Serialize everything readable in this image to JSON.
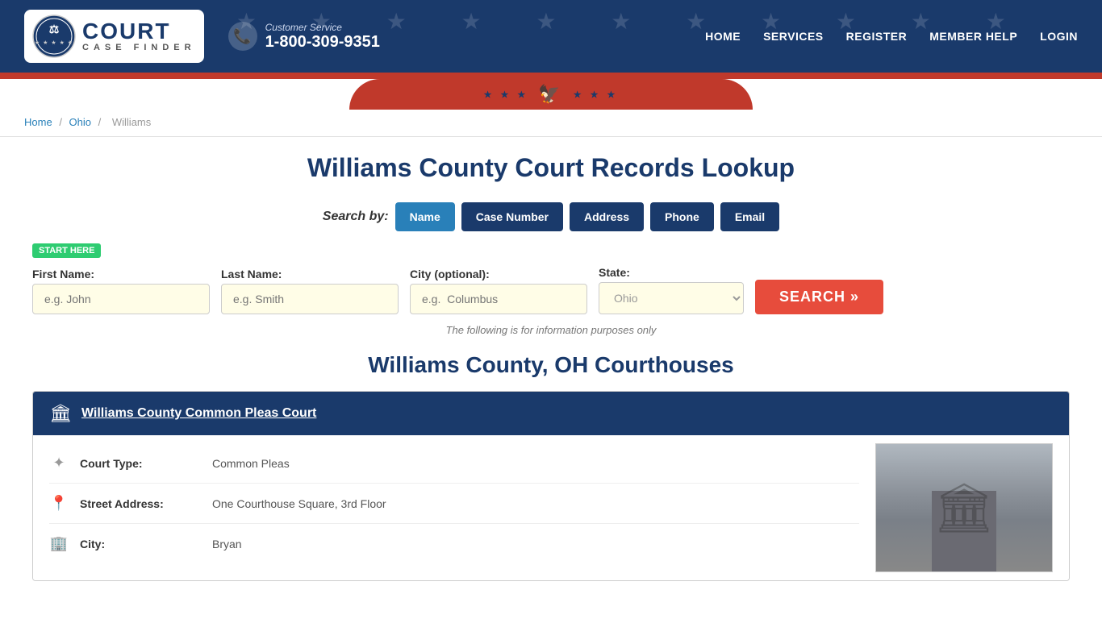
{
  "header": {
    "logo_court": "COURT",
    "logo_case_finder": "CASE FINDER",
    "customer_service_label": "Customer Service",
    "phone": "1-800-309-9351",
    "nav": {
      "home": "HOME",
      "services": "SERVICES",
      "register": "REGISTER",
      "member_help": "MEMBER HELP",
      "login": "LOGIN"
    }
  },
  "breadcrumb": {
    "home": "Home",
    "ohio": "Ohio",
    "williams": "Williams"
  },
  "main": {
    "page_title": "Williams County Court Records Lookup",
    "search_by_label": "Search by:",
    "tabs": [
      {
        "label": "Name",
        "active": true
      },
      {
        "label": "Case Number",
        "active": false
      },
      {
        "label": "Address",
        "active": false
      },
      {
        "label": "Phone",
        "active": false
      },
      {
        "label": "Email",
        "active": false
      }
    ],
    "start_here": "START HERE",
    "form": {
      "first_name_label": "First Name:",
      "first_name_placeholder": "e.g. John",
      "last_name_label": "Last Name:",
      "last_name_placeholder": "e.g. Smith",
      "city_label": "City (optional):",
      "city_placeholder": "e.g.  Columbus",
      "state_label": "State:",
      "state_value": "Ohio",
      "search_button": "SEARCH »"
    },
    "info_text": "The following is for information purposes only",
    "courthouses_title": "Williams County, OH Courthouses",
    "courts": [
      {
        "name": "Williams County Common Pleas Court",
        "court_type_label": "Court Type:",
        "court_type_value": "Common Pleas",
        "street_address_label": "Street Address:",
        "street_address_value": "One Courthouse Square, 3rd Floor",
        "city_label": "City:",
        "city_value": "Bryan"
      }
    ]
  }
}
